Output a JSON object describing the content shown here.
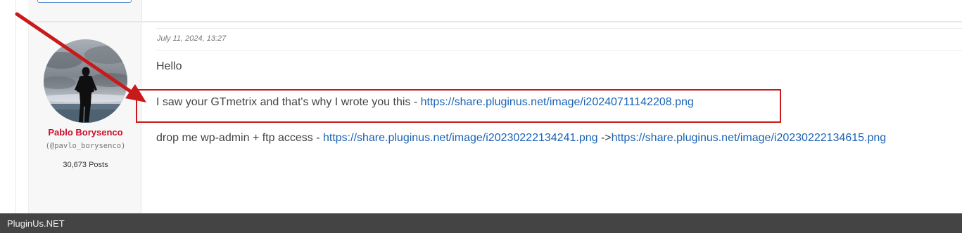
{
  "post": {
    "date": "July 11, 2024, 13:27",
    "author": {
      "name": "Pablo Borysenco",
      "handle": "(@pavlo_borysenco)",
      "posts": "30,673 Posts"
    },
    "lines": [
      {
        "text": "Hello"
      },
      {
        "text": "I saw your GTmetrix and that's why I wrote you this - ",
        "link": "https://share.pluginus.net/image/i20240711142208.png"
      },
      {
        "text": "drop me  wp-admin + ftp access - ",
        "link": "https://share.pluginus.net/image/i20230222134241.png",
        "sep": " ->",
        "link2": "https://share.pluginus.net/image/i20230222134615.png"
      }
    ]
  },
  "annotation": {
    "color": "#c81a1a"
  },
  "footer": {
    "brand": "PluginUs.NET"
  },
  "colors": {
    "link": "#1a63b5",
    "author_name": "#c8102e",
    "footer_bg": "#444444"
  }
}
